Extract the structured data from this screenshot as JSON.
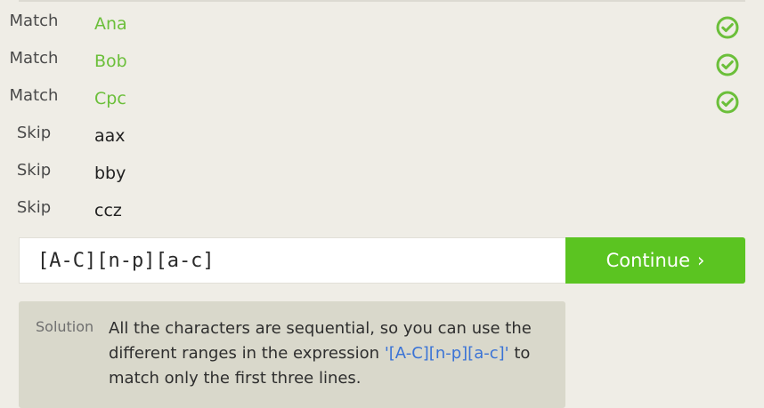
{
  "tasks": [
    {
      "action": "Match",
      "text": "Ana",
      "type": "match",
      "status_icon": "check-circle-icon"
    },
    {
      "action": "Match",
      "text": "Bob",
      "type": "match",
      "status_icon": "check-circle-icon"
    },
    {
      "action": "Match",
      "text": "Cpc",
      "type": "match",
      "status_icon": "check-circle-icon"
    },
    {
      "action": "Skip",
      "text": "aax",
      "type": "skip"
    },
    {
      "action": "Skip",
      "text": "bby",
      "type": "skip"
    },
    {
      "action": "Skip",
      "text": "ccz",
      "type": "skip"
    }
  ],
  "input": {
    "value": "[A-C][n-p][a-c]"
  },
  "continue_button": {
    "label": "Continue",
    "arrow": "›"
  },
  "solution": {
    "label": "Solution",
    "text_before": "All the characters are sequential, so you can use the different ranges in the expression ",
    "code": "'[A-C][n-p][a-c]'",
    "text_after": " to match only the first three lines."
  },
  "colors": {
    "background": "#efede6",
    "match_text": "#6bbf3a",
    "success_icon": "#6bbf3a",
    "continue": "#5bc421",
    "solution_bg": "#d9d8cb",
    "code_text": "#3a73d6"
  }
}
